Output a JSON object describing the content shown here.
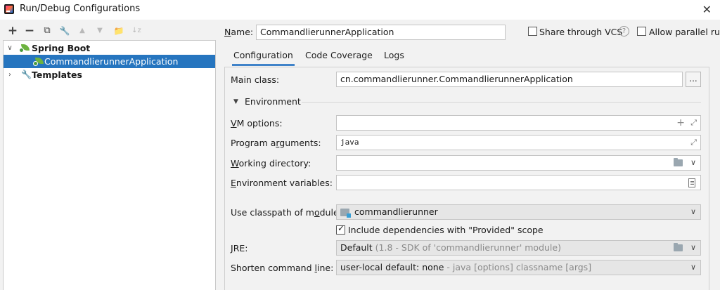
{
  "window": {
    "title": "Run/Debug Configurations"
  },
  "toolbar": {
    "add": "+",
    "remove": "−",
    "copy": "⧉",
    "edit": "🔧",
    "up": "▲",
    "down": "▼",
    "folder": "📁",
    "sort": "↓z"
  },
  "tree": {
    "spring_boot": "Spring Boot",
    "app": "CommandlierunnerApplication",
    "templates": "Templates"
  },
  "name_field": {
    "label": "Name:",
    "value": "CommandlierunnerApplication"
  },
  "share_vcs": {
    "label": "Share through VCS",
    "checked": false
  },
  "allow_parallel": {
    "label": "Allow parallel run",
    "checked": false
  },
  "tabs": [
    {
      "label": "Configuration",
      "active": true
    },
    {
      "label": "Code Coverage",
      "active": false
    },
    {
      "label": "Logs",
      "active": false
    }
  ],
  "main_class": {
    "label": "Main class:",
    "value": "cn.commandlierunner.CommandlierunnerApplication",
    "browse": "..."
  },
  "environment": {
    "label": "Environment"
  },
  "vm_options": {
    "label": "VM options:",
    "value": ""
  },
  "program_args": {
    "label": "Program arguments:",
    "value": "java"
  },
  "working_dir": {
    "label": "Working directory:",
    "value": ""
  },
  "env_vars": {
    "label": "Environment variables:",
    "value": ""
  },
  "classpath": {
    "label": "Use classpath of module:",
    "value": "commandlierunner"
  },
  "include_deps": {
    "label": "Include dependencies with \"Provided\" scope",
    "checked": true
  },
  "jre": {
    "label": "JRE:",
    "value": "Default",
    "hint": "(1.8 - SDK of 'commandlierunner' module)"
  },
  "shorten": {
    "label": "Shorten command line:",
    "value": "user-local default: none",
    "hint": "- java [options] classname [args]"
  }
}
